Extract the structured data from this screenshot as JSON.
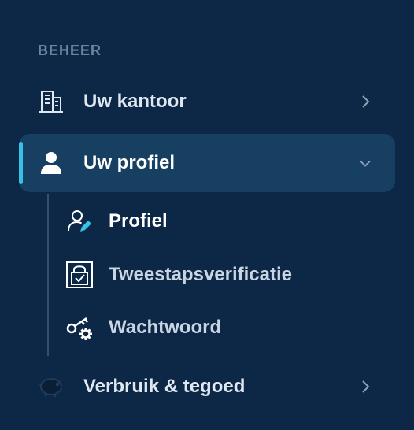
{
  "sidebar": {
    "section_title": "BEHEER",
    "items": [
      {
        "label": "Uw kantoor",
        "icon": "building-icon",
        "state": "collapsed"
      },
      {
        "label": "Uw profiel",
        "icon": "user-icon",
        "state": "expanded"
      },
      {
        "label": "Verbruik & tegoed",
        "icon": "piggy-bank-icon",
        "state": "collapsed"
      }
    ],
    "subitems": [
      {
        "label": "Profiel",
        "icon": "user-edit-icon",
        "active": true
      },
      {
        "label": "Tweestapsverificatie",
        "icon": "lock-check-icon",
        "active": false
      },
      {
        "label": "Wachtwoord",
        "icon": "key-gear-icon",
        "active": false
      }
    ]
  },
  "colors": {
    "background": "#0d2847",
    "active_item_bg": "#163f61",
    "accent": "#35c1e8",
    "section_title": "#6e84a0",
    "text": "#dfe7f0"
  }
}
